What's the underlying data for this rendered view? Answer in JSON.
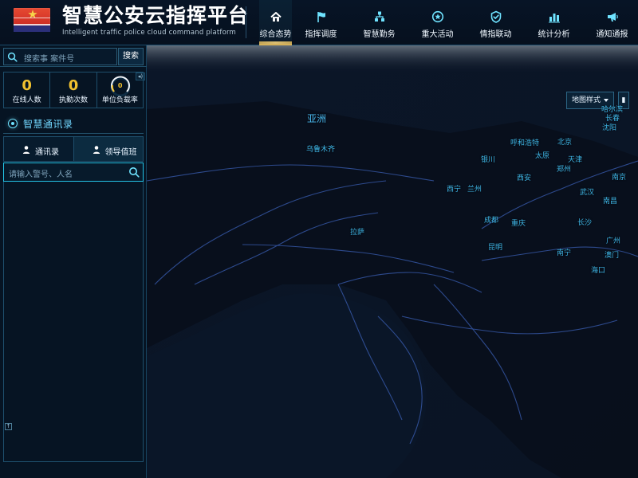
{
  "header": {
    "title": "智慧公安云指挥平台",
    "subtitle": "Intelligent traffic police cloud command platform"
  },
  "nav": [
    {
      "label": "综合态势",
      "icon": "home-icon",
      "active": true
    },
    {
      "label": "指挥调度",
      "icon": "flag-icon",
      "active": false
    },
    {
      "label": "智慧勤务",
      "icon": "org-chart-icon",
      "active": false
    },
    {
      "label": "重大活动",
      "icon": "star-circle-icon",
      "active": false
    },
    {
      "label": "情指联动",
      "icon": "shield-check-icon",
      "active": false
    },
    {
      "label": "统计分析",
      "icon": "bar-chart-icon",
      "active": false
    },
    {
      "label": "通知通报",
      "icon": "megaphone-icon",
      "active": false
    }
  ],
  "left_panel": {
    "search": {
      "placeholder": "搜索事 案件号",
      "button": "搜索"
    },
    "stats": [
      {
        "value": "0",
        "label": "在线人数"
      },
      {
        "value": "0",
        "label": "执勤次数"
      },
      {
        "value": "0",
        "label": "单位负载率"
      }
    ],
    "section_title": "智慧通讯录",
    "tabs": [
      {
        "label": "通讯录",
        "active": false
      },
      {
        "label": "领导值班",
        "active": true
      }
    ],
    "contact_search": {
      "placeholder": "请输入警号、人名"
    }
  },
  "map": {
    "region_label": "亚洲",
    "labels": [
      {
        "text": "哈尔滨"
      },
      {
        "text": "长春"
      },
      {
        "text": "沈阳"
      },
      {
        "text": "呼和浩特"
      },
      {
        "text": "北京"
      },
      {
        "text": "天津"
      },
      {
        "text": "太原"
      },
      {
        "text": "银川"
      },
      {
        "text": "郑州"
      },
      {
        "text": "西安"
      },
      {
        "text": "南京"
      },
      {
        "text": "西宁"
      },
      {
        "text": "兰州"
      },
      {
        "text": "武汉"
      },
      {
        "text": "南昌"
      },
      {
        "text": "成都"
      },
      {
        "text": "重庆"
      },
      {
        "text": "长沙"
      },
      {
        "text": "广州"
      },
      {
        "text": "南宁"
      },
      {
        "text": "澳门"
      },
      {
        "text": "昆明"
      },
      {
        "text": "海口"
      },
      {
        "text": "拉萨"
      },
      {
        "text": "乌鲁木齐"
      }
    ],
    "controls": {
      "style_label": "地图样式"
    }
  },
  "colors": {
    "accent": "#23c3e6",
    "gold": "#f1c12f",
    "active_nav": "#d7b35a"
  }
}
